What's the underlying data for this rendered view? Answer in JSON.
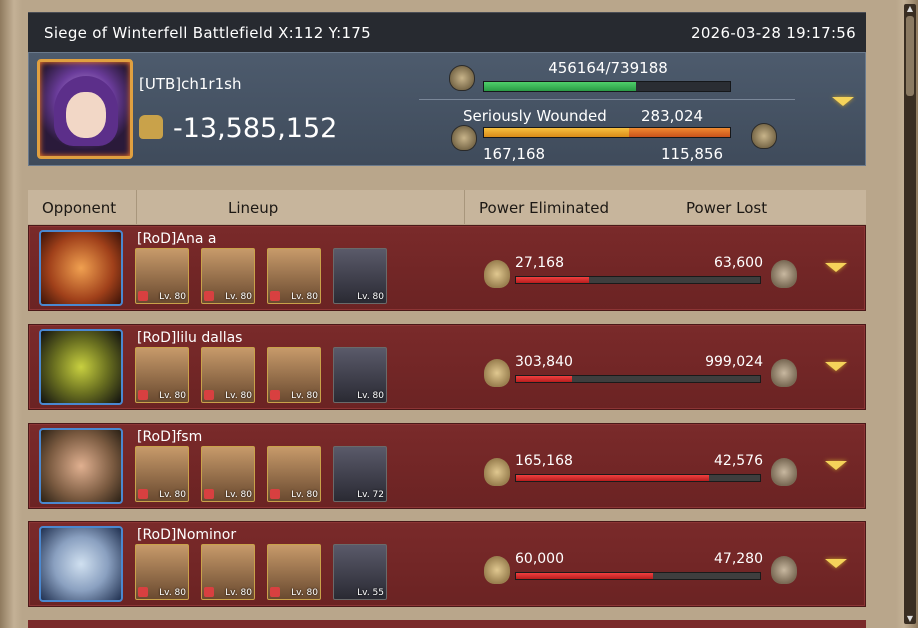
{
  "header": {
    "title": "Siege of Winterfell Battlefield X:112 Y:175",
    "timestamp": "2026-03-28 19:17:56"
  },
  "player": {
    "name": "[UTB]ch1r1sh",
    "power": "-13,585,152",
    "hp_text": "456164/739188",
    "hp_fraction": 0.617,
    "wounded_label": "Seriously Wounded",
    "wounded_value": "283,024",
    "wounded_left": "167,168",
    "wounded_right": "115,856",
    "wounded_split": 0.59
  },
  "columns": {
    "opponent": "Opponent",
    "lineup": "Lineup",
    "eliminated": "Power Eliminated",
    "lost": "Power Lost"
  },
  "rows": [
    {
      "name": "[RoD]Ana a",
      "eliminated": "27,168",
      "lost": "63,600",
      "bar_fraction": 0.3,
      "heroes": [
        {
          "lv": "Lv. 80",
          "type": "hero"
        },
        {
          "lv": "Lv. 80",
          "type": "hero"
        },
        {
          "lv": "Lv. 80",
          "type": "hero"
        },
        {
          "lv": "Lv. 80",
          "type": "dragon"
        }
      ]
    },
    {
      "name": "[RoD]lilu dallas",
      "eliminated": "303,840",
      "lost": "999,024",
      "bar_fraction": 0.23,
      "heroes": [
        {
          "lv": "Lv. 80",
          "type": "hero"
        },
        {
          "lv": "Lv. 80",
          "type": "hero"
        },
        {
          "lv": "Lv. 80",
          "type": "hero"
        },
        {
          "lv": "Lv. 80",
          "type": "dragon"
        }
      ]
    },
    {
      "name": "[RoD]fsm",
      "eliminated": "165,168",
      "lost": "42,576",
      "bar_fraction": 0.79,
      "heroes": [
        {
          "lv": "Lv. 80",
          "type": "hero"
        },
        {
          "lv": "Lv. 80",
          "type": "hero"
        },
        {
          "lv": "Lv. 80",
          "type": "hero"
        },
        {
          "lv": "Lv. 72",
          "type": "dragon"
        }
      ]
    },
    {
      "name": "[RoD]Nominor",
      "eliminated": "60,000",
      "lost": "47,280",
      "bar_fraction": 0.56,
      "heroes": [
        {
          "lv": "Lv. 80",
          "type": "hero"
        },
        {
          "lv": "Lv. 80",
          "type": "hero"
        },
        {
          "lv": "Lv. 80",
          "type": "hero"
        },
        {
          "lv": "Lv. 55",
          "type": "dragon"
        }
      ]
    }
  ]
}
